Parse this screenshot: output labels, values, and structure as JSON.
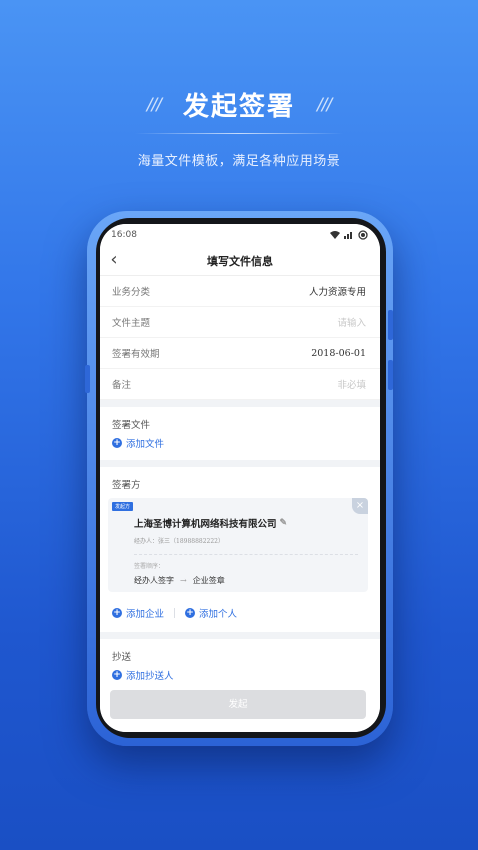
{
  "promo": {
    "slashes_left": "///",
    "title": "发起签署",
    "slashes_right": "///",
    "subtitle": "海量文件模板，满足各种应用场景"
  },
  "status_bar": {
    "time": "16:08"
  },
  "nav": {
    "back_icon": "‹",
    "title": "填写文件信息"
  },
  "form": {
    "rows": [
      {
        "label": "业务分类",
        "value": "人力资源专用"
      },
      {
        "label": "文件主题",
        "placeholder": "请输入"
      },
      {
        "label": "签署有效期",
        "value": "2018-06-01"
      },
      {
        "label": "备注",
        "placeholder": "非必填"
      }
    ]
  },
  "sign_file": {
    "title": "签署文件",
    "add_label": "添加文件"
  },
  "signers": {
    "title": "签署方",
    "card": {
      "tag": "发起方",
      "company": "上海圣博计算机网络科技有限公司",
      "handler": "经办人：张三（18988882222）",
      "order_label": "签署顺序：",
      "step1": "经办人签字",
      "arrow": "→",
      "step2": "企业签章"
    },
    "add_company": "添加企业",
    "add_person": "添加个人"
  },
  "cc": {
    "title": "抄送",
    "add_label": "添加抄送人"
  },
  "submit_label": "发起",
  "colors": {
    "accent": "#2f6fe0",
    "bg_top": "#4a94f4",
    "bg_bottom": "#1a4fc4"
  }
}
